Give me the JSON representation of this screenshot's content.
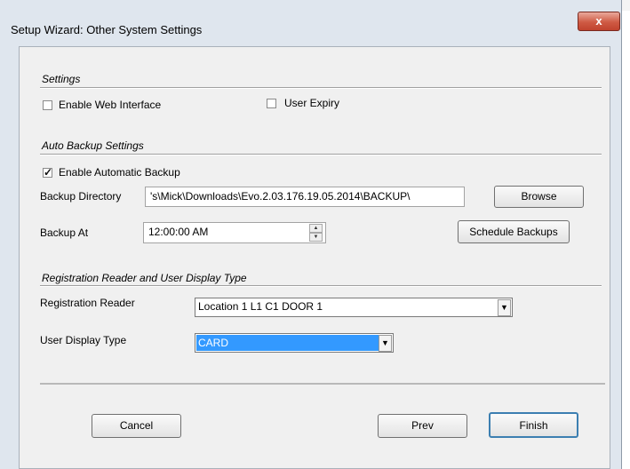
{
  "window": {
    "title": "Setup Wizard: Other System Settings",
    "close_glyph": "x"
  },
  "settings": {
    "group_title": "Settings",
    "enable_web_interface": {
      "label": "Enable Web Interface",
      "checked": false
    },
    "user_expiry": {
      "label": "User Expiry",
      "checked": false
    }
  },
  "auto_backup": {
    "group_title": "Auto Backup Settings",
    "enable_automatic_backup": {
      "label": "Enable Automatic Backup",
      "checked": true
    },
    "backup_directory_label": "Backup Directory",
    "backup_directory_value": "'s\\Mick\\Downloads\\Evo.2.03.176.19.05.2014\\BACKUP\\",
    "browse_label": "Browse",
    "backup_at_label": "Backup At",
    "backup_at_value": "12:00:00 AM",
    "schedule_backups_label": "Schedule Backups"
  },
  "registration": {
    "group_title": "Registration Reader and User Display Type",
    "reader_label": "Registration Reader",
    "reader_value": "Location 1 L1 C1 DOOR 1",
    "display_type_label": "User Display Type",
    "display_type_value": "CARD"
  },
  "footer": {
    "cancel_label": "Cancel",
    "prev_label": "Prev",
    "finish_label": "Finish"
  },
  "icons": {
    "check_mark": "✓",
    "spin_up": "▲",
    "spin_down": "▼",
    "dropdown": "▼"
  },
  "colors": {
    "window_frame": "#dfe6ee",
    "client_bg": "#f0f0f0",
    "close_button": "#cf5a44",
    "selection": "#3399ff"
  }
}
